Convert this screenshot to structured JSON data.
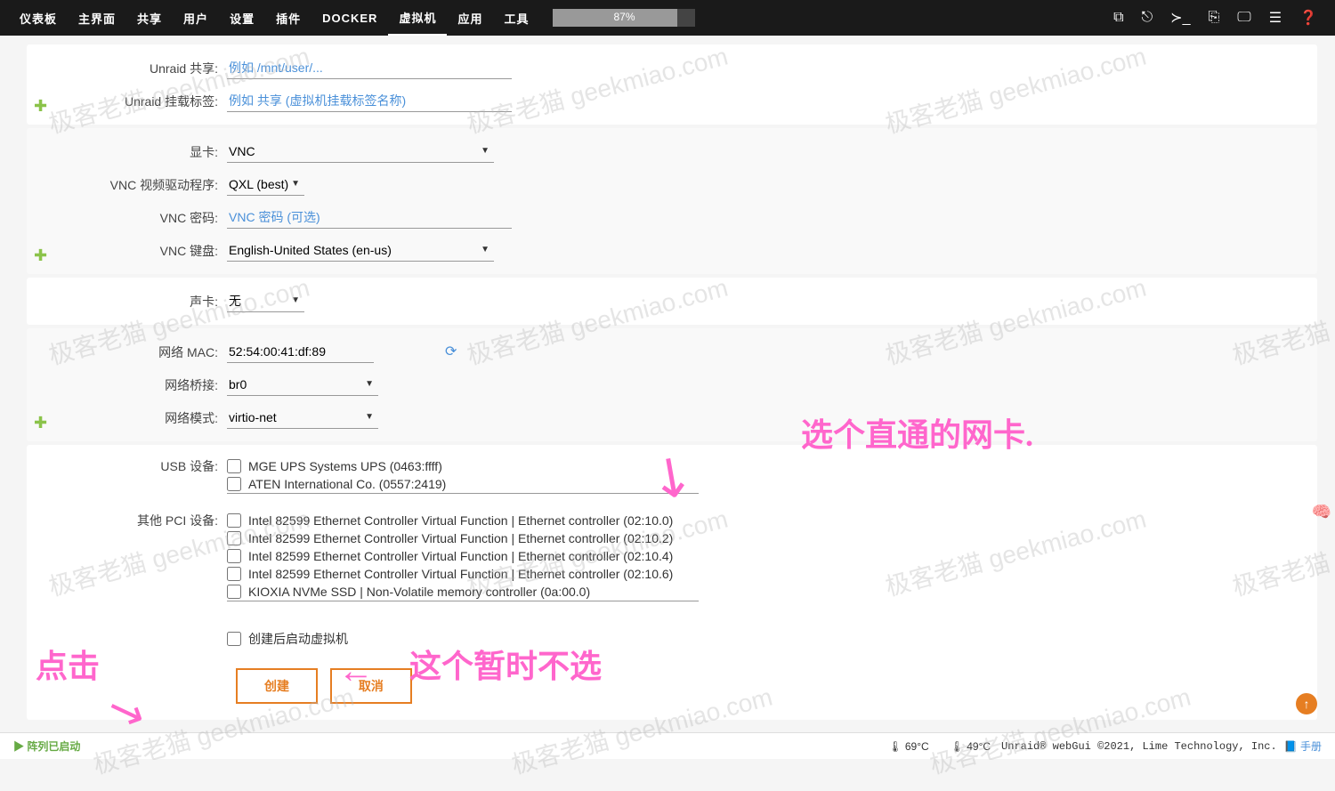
{
  "nav": [
    "仪表板",
    "主界面",
    "共享",
    "用户",
    "设置",
    "插件",
    "DOCKER",
    "虚拟机",
    "应用",
    "工具"
  ],
  "nav_active": 7,
  "progress": "87%",
  "form": {
    "share_label": "Unraid 共享:",
    "share_ph": "例如 /mnt/user/...",
    "mount_label": "Unraid 挂载标签:",
    "mount_ph": "例如 共享 (虚拟机挂载标签名称)",
    "gpu_label": "显卡:",
    "gpu_value": "VNC",
    "vnc_driver_label": "VNC 视频驱动程序:",
    "vnc_driver_value": "QXL (best)",
    "vnc_pw_label": "VNC 密码:",
    "vnc_pw_ph": "VNC 密码 (可选)",
    "vnc_kb_label": "VNC 键盘:",
    "vnc_kb_value": "English-United States (en-us)",
    "sound_label": "声卡:",
    "sound_value": "无",
    "mac_label": "网络 MAC:",
    "mac_value": "52:54:00:41:df:89",
    "bridge_label": "网络桥接:",
    "bridge_value": "br0",
    "netmodel_label": "网络模式:",
    "netmodel_value": "virtio-net",
    "usb_label": "USB 设备:",
    "usb_items": [
      "MGE UPS Systems UPS (0463:ffff)",
      "ATEN International Co. (0557:2419)"
    ],
    "pci_label": "其他 PCI 设备:",
    "pci_items": [
      "Intel 82599 Ethernet Controller Virtual Function | Ethernet controller (02:10.0)",
      "Intel 82599 Ethernet Controller Virtual Function | Ethernet controller (02:10.2)",
      "Intel 82599 Ethernet Controller Virtual Function | Ethernet controller (02:10.4)",
      "Intel 82599 Ethernet Controller Virtual Function | Ethernet controller (02:10.6)",
      "KIOXIA NVMe SSD | Non-Volatile memory controller (0a:00.0)"
    ],
    "start_after_label": "创建后启动虚拟机",
    "create_btn": "创建",
    "cancel_btn": "取消"
  },
  "footer": {
    "status": "▶ 阵列已启动",
    "cpu_temp": "69°C",
    "mb_temp": "49°C",
    "copyright": "Unraid® webGui ©2021, Lime Technology, Inc.",
    "manual": "手册"
  },
  "watermark": "极客老猫 geekmiao.com",
  "annotations": {
    "a1": "选个直通的网卡.",
    "a2": "这个暂时不选",
    "a3": "点击"
  }
}
